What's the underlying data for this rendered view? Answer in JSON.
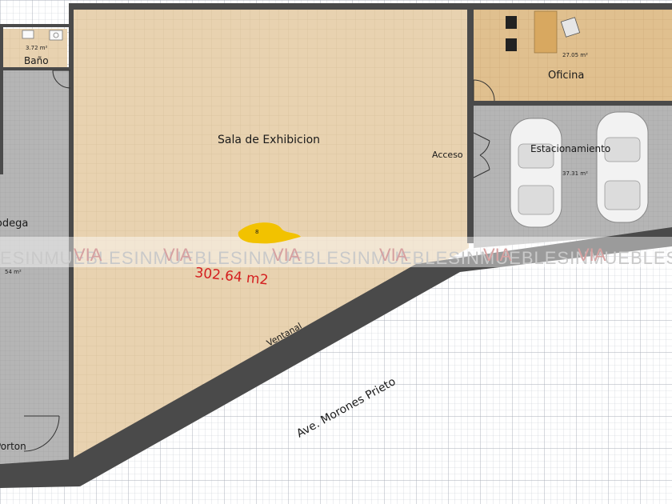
{
  "rooms": {
    "bano": {
      "name": "Baño",
      "area": "3.72 m²"
    },
    "bodega": {
      "name": "Bodega",
      "area": "54 m²"
    },
    "sala": {
      "name": "Sala de Exhibicion"
    },
    "oficina": {
      "name": "Oficina",
      "area": "27.05 m²"
    },
    "estacionamiento": {
      "name": "Estacionamiento",
      "area": "37.31 m²"
    }
  },
  "labels": {
    "acceso": "Acceso",
    "ventanal": "Ventanal",
    "street": "Ave. Morones Prieto",
    "porton": "Porton",
    "total_area": "302.64 m2",
    "marker": "8"
  },
  "watermark": {
    "text": "ESINMUEBLESINMUEBLESINMUEBLESINMUEBLESINMUEBLESINMUEBLES",
    "brand_letters": "VIA"
  },
  "colors": {
    "floor_wood": "#e8d2b0",
    "floor_office": "#e0c08f",
    "floor_concrete": "#b5b5b5",
    "wall": "#4a4a4a",
    "area_text": "#d42020",
    "marker": "#f2c200"
  }
}
